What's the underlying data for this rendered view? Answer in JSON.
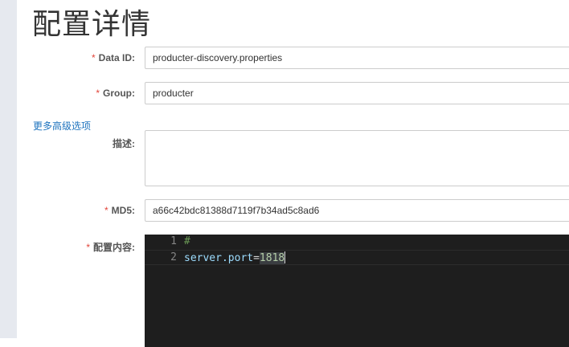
{
  "page": {
    "title": "配置详情"
  },
  "form": {
    "required_mark": "*",
    "data_id": {
      "label": "Data ID:",
      "value": "producter-discovery.properties"
    },
    "group": {
      "label": "Group:",
      "value": "producter"
    },
    "advanced_link": "更多高级选项",
    "description": {
      "label": "描述:",
      "value": ""
    },
    "md5": {
      "label": "MD5:",
      "value": "a66c42bdc81388d7119f7b34ad5c8ad6"
    },
    "content": {
      "label": "配置内容:"
    }
  },
  "editor": {
    "lines": [
      {
        "num": "1",
        "comment": "#"
      },
      {
        "num": "2",
        "key": "server.port",
        "op": "=",
        "value": "1818"
      }
    ]
  },
  "colors": {
    "required": "#e2453a",
    "link": "#1e73be",
    "editor_bg": "#1e1e1e"
  }
}
